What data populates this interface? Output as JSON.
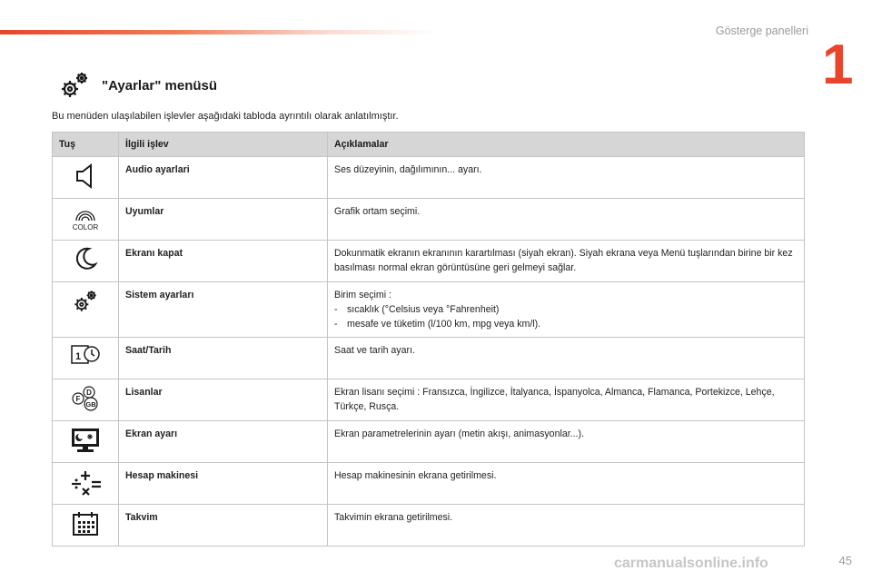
{
  "header": {
    "section": "Gösterge panelleri",
    "chapter": "1"
  },
  "page": {
    "title": "\"Ayarlar\" menüsü",
    "intro": "Bu menüden ulaşılabilen işlevler aşağıdaki tabloda ayrıntılı olarak anlatılmıştır.",
    "number": "45"
  },
  "table": {
    "headers": {
      "key": "Tuş",
      "func": "İlgili işlev",
      "desc": "Açıklamalar"
    },
    "rows": [
      {
        "icon": "speaker-icon",
        "func": "Audio ayarlari",
        "desc": "Ses düzeyinin, dağılımının... ayarı."
      },
      {
        "icon": "color-icon",
        "icon_label": "COLOR",
        "func": "Uyumlar",
        "desc": "Grafik ortam seçimi."
      },
      {
        "icon": "moon-icon",
        "func": "Ekranı kapat",
        "desc": "Dokunmatik ekranın ekranının karartılması (siyah ekran). Siyah ekrana veya Menü tuşlarından birine bir kez basılması normal ekran görüntüsüne geri gelmeyi sağlar."
      },
      {
        "icon": "gears-icon",
        "func": "Sistem ayarları",
        "desc": "Birim seçimi :",
        "items": [
          "sıcaklık (°Celsius veya °Fahrenheit)",
          "mesafe ve tüketim (l/100 km, mpg veya km/l)."
        ]
      },
      {
        "icon": "clock-calendar-icon",
        "icon_label": "1",
        "func": "Saat/Tarih",
        "desc": "Saat ve tarih ayarı."
      },
      {
        "icon": "languages-icon",
        "icon_labels": [
          "F",
          "D",
          "GB"
        ],
        "func": "Lisanlar",
        "desc": "Ekran lisanı seçimi : Fransızca, İngilizce, İtalyanca, İspanyolca, Almanca, Flamanca, Portekizce, Lehçe, Türkçe, Rusça."
      },
      {
        "icon": "display-settings-icon",
        "func": "Ekran ayarı",
        "desc": "Ekran parametrelerinin ayarı (metin akışı, animasyonlar...)."
      },
      {
        "icon": "calculator-icon",
        "func": "Hesap makinesi",
        "desc": "Hesap makinesinin ekrana getirilmesi."
      },
      {
        "icon": "calendar-icon",
        "func": "Takvim",
        "desc": "Takvimin ekrana getirilmesi."
      }
    ]
  },
  "watermark": "carmanualsonline.info",
  "colors": {
    "accent": "#e8452c",
    "header_bg": "#d6d6d6",
    "border": "#c4c4c4"
  }
}
